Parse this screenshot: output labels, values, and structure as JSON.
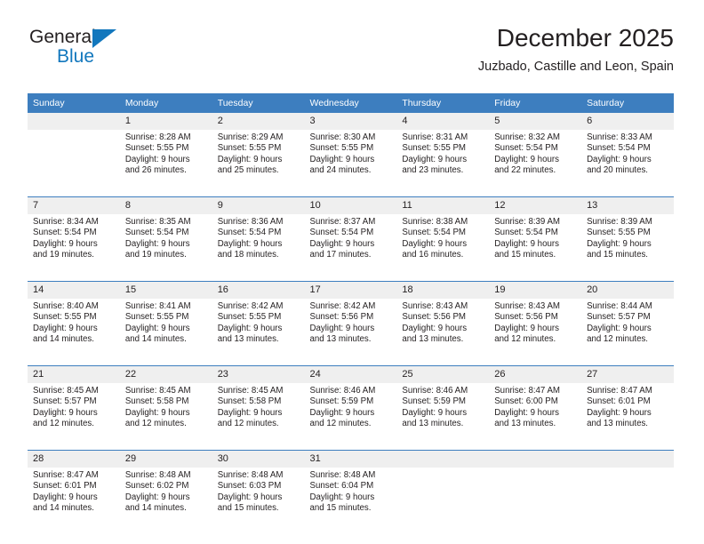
{
  "brand": {
    "name_top": "General",
    "name_bottom": "Blue",
    "colors": {
      "blue": "#1277bd",
      "dark": "#231f20"
    }
  },
  "header": {
    "title": "December 2025",
    "subtitle": "Juzbado, Castille and Leon, Spain"
  },
  "theme": {
    "header_blue": "#3d7ebf",
    "daynum_background": "#efefef",
    "text": "#231f20"
  },
  "calendar": {
    "weekday_headers": [
      "Sunday",
      "Monday",
      "Tuesday",
      "Wednesday",
      "Thursday",
      "Friday",
      "Saturday"
    ],
    "weeks": [
      [
        {
          "day": "",
          "lines": []
        },
        {
          "day": "1",
          "lines": [
            "Sunrise: 8:28 AM",
            "Sunset: 5:55 PM",
            "Daylight: 9 hours",
            "and 26 minutes."
          ]
        },
        {
          "day": "2",
          "lines": [
            "Sunrise: 8:29 AM",
            "Sunset: 5:55 PM",
            "Daylight: 9 hours",
            "and 25 minutes."
          ]
        },
        {
          "day": "3",
          "lines": [
            "Sunrise: 8:30 AM",
            "Sunset: 5:55 PM",
            "Daylight: 9 hours",
            "and 24 minutes."
          ]
        },
        {
          "day": "4",
          "lines": [
            "Sunrise: 8:31 AM",
            "Sunset: 5:55 PM",
            "Daylight: 9 hours",
            "and 23 minutes."
          ]
        },
        {
          "day": "5",
          "lines": [
            "Sunrise: 8:32 AM",
            "Sunset: 5:54 PM",
            "Daylight: 9 hours",
            "and 22 minutes."
          ]
        },
        {
          "day": "6",
          "lines": [
            "Sunrise: 8:33 AM",
            "Sunset: 5:54 PM",
            "Daylight: 9 hours",
            "and 20 minutes."
          ]
        }
      ],
      [
        {
          "day": "7",
          "lines": [
            "Sunrise: 8:34 AM",
            "Sunset: 5:54 PM",
            "Daylight: 9 hours",
            "and 19 minutes."
          ]
        },
        {
          "day": "8",
          "lines": [
            "Sunrise: 8:35 AM",
            "Sunset: 5:54 PM",
            "Daylight: 9 hours",
            "and 19 minutes."
          ]
        },
        {
          "day": "9",
          "lines": [
            "Sunrise: 8:36 AM",
            "Sunset: 5:54 PM",
            "Daylight: 9 hours",
            "and 18 minutes."
          ]
        },
        {
          "day": "10",
          "lines": [
            "Sunrise: 8:37 AM",
            "Sunset: 5:54 PM",
            "Daylight: 9 hours",
            "and 17 minutes."
          ]
        },
        {
          "day": "11",
          "lines": [
            "Sunrise: 8:38 AM",
            "Sunset: 5:54 PM",
            "Daylight: 9 hours",
            "and 16 minutes."
          ]
        },
        {
          "day": "12",
          "lines": [
            "Sunrise: 8:39 AM",
            "Sunset: 5:54 PM",
            "Daylight: 9 hours",
            "and 15 minutes."
          ]
        },
        {
          "day": "13",
          "lines": [
            "Sunrise: 8:39 AM",
            "Sunset: 5:55 PM",
            "Daylight: 9 hours",
            "and 15 minutes."
          ]
        }
      ],
      [
        {
          "day": "14",
          "lines": [
            "Sunrise: 8:40 AM",
            "Sunset: 5:55 PM",
            "Daylight: 9 hours",
            "and 14 minutes."
          ]
        },
        {
          "day": "15",
          "lines": [
            "Sunrise: 8:41 AM",
            "Sunset: 5:55 PM",
            "Daylight: 9 hours",
            "and 14 minutes."
          ]
        },
        {
          "day": "16",
          "lines": [
            "Sunrise: 8:42 AM",
            "Sunset: 5:55 PM",
            "Daylight: 9 hours",
            "and 13 minutes."
          ]
        },
        {
          "day": "17",
          "lines": [
            "Sunrise: 8:42 AM",
            "Sunset: 5:56 PM",
            "Daylight: 9 hours",
            "and 13 minutes."
          ]
        },
        {
          "day": "18",
          "lines": [
            "Sunrise: 8:43 AM",
            "Sunset: 5:56 PM",
            "Daylight: 9 hours",
            "and 13 minutes."
          ]
        },
        {
          "day": "19",
          "lines": [
            "Sunrise: 8:43 AM",
            "Sunset: 5:56 PM",
            "Daylight: 9 hours",
            "and 12 minutes."
          ]
        },
        {
          "day": "20",
          "lines": [
            "Sunrise: 8:44 AM",
            "Sunset: 5:57 PM",
            "Daylight: 9 hours",
            "and 12 minutes."
          ]
        }
      ],
      [
        {
          "day": "21",
          "lines": [
            "Sunrise: 8:45 AM",
            "Sunset: 5:57 PM",
            "Daylight: 9 hours",
            "and 12 minutes."
          ]
        },
        {
          "day": "22",
          "lines": [
            "Sunrise: 8:45 AM",
            "Sunset: 5:58 PM",
            "Daylight: 9 hours",
            "and 12 minutes."
          ]
        },
        {
          "day": "23",
          "lines": [
            "Sunrise: 8:45 AM",
            "Sunset: 5:58 PM",
            "Daylight: 9 hours",
            "and 12 minutes."
          ]
        },
        {
          "day": "24",
          "lines": [
            "Sunrise: 8:46 AM",
            "Sunset: 5:59 PM",
            "Daylight: 9 hours",
            "and 12 minutes."
          ]
        },
        {
          "day": "25",
          "lines": [
            "Sunrise: 8:46 AM",
            "Sunset: 5:59 PM",
            "Daylight: 9 hours",
            "and 13 minutes."
          ]
        },
        {
          "day": "26",
          "lines": [
            "Sunrise: 8:47 AM",
            "Sunset: 6:00 PM",
            "Daylight: 9 hours",
            "and 13 minutes."
          ]
        },
        {
          "day": "27",
          "lines": [
            "Sunrise: 8:47 AM",
            "Sunset: 6:01 PM",
            "Daylight: 9 hours",
            "and 13 minutes."
          ]
        }
      ],
      [
        {
          "day": "28",
          "lines": [
            "Sunrise: 8:47 AM",
            "Sunset: 6:01 PM",
            "Daylight: 9 hours",
            "and 14 minutes."
          ]
        },
        {
          "day": "29",
          "lines": [
            "Sunrise: 8:48 AM",
            "Sunset: 6:02 PM",
            "Daylight: 9 hours",
            "and 14 minutes."
          ]
        },
        {
          "day": "30",
          "lines": [
            "Sunrise: 8:48 AM",
            "Sunset: 6:03 PM",
            "Daylight: 9 hours",
            "and 15 minutes."
          ]
        },
        {
          "day": "31",
          "lines": [
            "Sunrise: 8:48 AM",
            "Sunset: 6:04 PM",
            "Daylight: 9 hours",
            "and 15 minutes."
          ]
        },
        {
          "day": "",
          "lines": []
        },
        {
          "day": "",
          "lines": []
        },
        {
          "day": "",
          "lines": []
        }
      ]
    ]
  }
}
